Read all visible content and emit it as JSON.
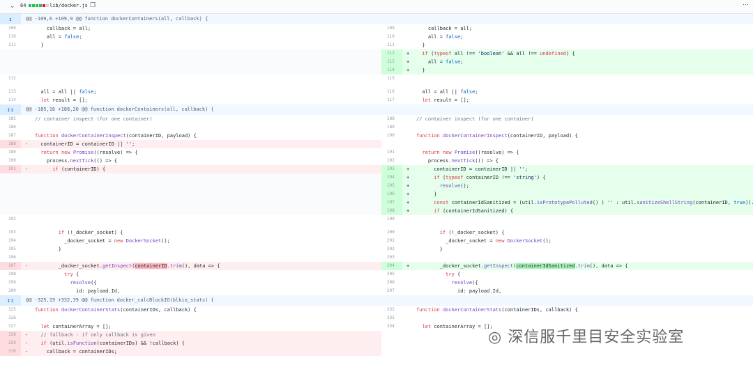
{
  "file": {
    "count": "64",
    "path": "lib/docker.js",
    "bar_colors": [
      "#2cbe4e",
      "#2cbe4e",
      "#2cbe4e",
      "#2cbe4e",
      "#cb2431",
      "#d1d5da"
    ]
  },
  "hunks": [
    {
      "text": "@@ -109,6 +109,9 @@ function dockerContainers(all, callback) {",
      "icon": "↥"
    },
    {
      "text": "@@ -185,16 +188,20 @@ function dockerContainers(all, callback) {",
      "icon": "↧↥"
    },
    {
      "text": "@@ -325,19 +332,39 @@ function docker_calcBlockIO(blkio_stats) {",
      "icon": "↧↥"
    }
  ],
  "rows": [
    {
      "ln": "109",
      "lt": "    callback = all;",
      "rn": "109",
      "rt": "    callback = all;"
    },
    {
      "ln": "110",
      "lt": "    all = false;",
      "rn": "110",
      "rt": "    all = false;"
    },
    {
      "ln": "111",
      "lt": "  }",
      "rn": "111",
      "rt": "  }"
    },
    {
      "ln": "",
      "lt": "",
      "rn": "112",
      "rm": "+",
      "rt": "  if (typeof all !== 'boolean' && all !== undefined) {",
      "rtype": "add"
    },
    {
      "ln": "",
      "lt": "",
      "rn": "113",
      "rm": "+",
      "rt": "    all = false;",
      "rtype": "add"
    },
    {
      "ln": "",
      "lt": "",
      "rn": "114",
      "rm": "+",
      "rt": "  }",
      "rtype": "add"
    },
    {
      "ln": "112",
      "lt": "",
      "rn": "115",
      "rt": ""
    },
    {
      "ln": "113",
      "lt": "  all = all || false;",
      "rn": "116",
      "rt": "  all = all || false;"
    },
    {
      "ln": "114",
      "lt": "  let result = [];",
      "rn": "117",
      "rt": "  let result = [];"
    },
    {
      "ln": "185",
      "lt": "// container inspect (for one container)",
      "rn": "188",
      "rt": "// container inspect (for one container)"
    },
    {
      "ln": "186",
      "lt": "",
      "rn": "189",
      "rt": ""
    },
    {
      "ln": "187",
      "lt": "function dockerContainerInspect(containerID, payload) {",
      "rn": "190",
      "rt": "function dockerContainerInspect(containerID, payload) {"
    },
    {
      "ln": "188",
      "lm": "-",
      "lt": "  containerID = containerID || '';",
      "ltype": "del",
      "rn": "",
      "rt": ""
    },
    {
      "ln": "189",
      "lt": "  return new Promise((resolve) => {",
      "rn": "191",
      "rt": "  return new Promise((resolve) => {"
    },
    {
      "ln": "190",
      "lt": "    process.nextTick(() => {",
      "rn": "192",
      "rt": "    process.nextTick(() => {"
    },
    {
      "ln": "191",
      "lm": "-",
      "lt": "      if (containerID) {",
      "ltype": "del",
      "rn": "193",
      "rm": "+",
      "rt": "      containerID = containerID || '';",
      "rtype": "add"
    },
    {
      "ln": "",
      "lt": "",
      "rn": "194",
      "rm": "+",
      "rt": "      if (typeof containerID !== 'string') {",
      "rtype": "add"
    },
    {
      "ln": "",
      "lt": "",
      "rn": "195",
      "rm": "+",
      "rt": "        resolve();",
      "rtype": "add"
    },
    {
      "ln": "",
      "lt": "",
      "rn": "196",
      "rm": "+",
      "rt": "      }",
      "rtype": "add"
    },
    {
      "ln": "",
      "lt": "",
      "rn": "197",
      "rm": "+",
      "rt": "      const containerIdSanitized = (util.isPrototypePolluted() ) '' : util.sanitizeShellString(containerID, true)).trim();",
      "rtype": "add"
    },
    {
      "ln": "",
      "lt": "",
      "rn": "198",
      "rm": "+",
      "rt": "      if (containerIdSanitized) {",
      "rtype": "add"
    },
    {
      "ln": "192",
      "lt": "",
      "rn": "199",
      "rt": ""
    },
    {
      "ln": "193",
      "lt": "        if (!_docker_socket) {",
      "rn": "200",
      "rt": "        if (!_docker_socket) {"
    },
    {
      "ln": "194",
      "lt": "          _docker_socket = new DockerSocket();",
      "rn": "201",
      "rt": "          _docker_socket = new DockerSocket();"
    },
    {
      "ln": "195",
      "lt": "        }",
      "rn": "202",
      "rt": "        }"
    },
    {
      "ln": "196",
      "lt": "",
      "rn": "203",
      "rt": ""
    },
    {
      "ln": "197",
      "lm": "-",
      "lt": "        _docker_socket.getInspect(containerID.trim(), data => {",
      "ltype": "del",
      "rn": "204",
      "rm": "+",
      "rt": "        _docker_socket.getInspect(containerIdSanitized.trim(), data => {",
      "rtype": "add"
    },
    {
      "ln": "198",
      "lt": "          try {",
      "rn": "205",
      "rt": "          try {"
    },
    {
      "ln": "199",
      "lt": "            resolve({",
      "rn": "206",
      "rt": "            resolve({"
    },
    {
      "ln": "200",
      "lt": "              id: payload.Id,",
      "rn": "207",
      "rt": "              id: payload.Id,"
    },
    {
      "ln": "325",
      "lt": "function dockerContainerStats(containerIDs, callback) {",
      "rn": "332",
      "rt": "function dockerContainerStats(containerIDs, callback) {"
    },
    {
      "ln": "326",
      "lt": "",
      "rn": "333",
      "rt": ""
    },
    {
      "ln": "327",
      "lt": "  let containerArray = [];",
      "rn": "334",
      "rt": "  let containerArray = [];"
    },
    {
      "ln": "328",
      "lm": "-",
      "lt": "  // fallback - if only callback is given",
      "ltype": "del",
      "rn": "",
      "rt": ""
    },
    {
      "ln": "329",
      "lm": "-",
      "lt": "  if (util.isFunction(containerIDs) && !callback) {",
      "ltype": "del",
      "rn": "",
      "rt": ""
    },
    {
      "ln": "330",
      "lm": "-",
      "lt": "    callback = containerIDs;",
      "ltype": "del",
      "rn": "",
      "rt": ""
    }
  ],
  "watermark": "深信服千里目安全实验室",
  "icons": {
    "expand_toggle": "chevron-down-icon",
    "copy": "clipboard-icon",
    "more": "kebab-icon",
    "watermark": "wechat-icon"
  }
}
